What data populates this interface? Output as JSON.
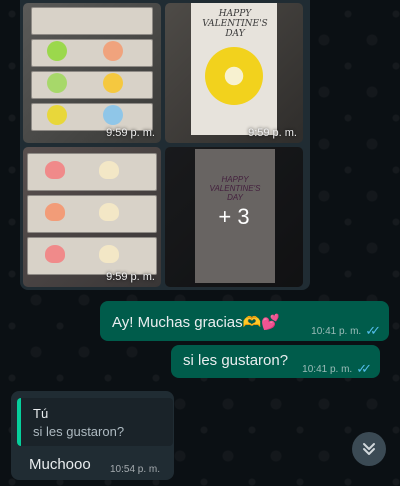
{
  "album": {
    "tiles": [
      {
        "time": "9:59 p. m."
      },
      {
        "time": "9:59 p. m.",
        "card_text": "HAPPY VALENTINE'S DAY"
      },
      {
        "time": "9:59 p. m."
      },
      {
        "overlay": "+ 3",
        "card_text": "HAPPY VALENTINE'S DAY"
      }
    ]
  },
  "messages": [
    {
      "text": "Ay! Muchas gracias🫶💕",
      "time": "10:41 p. m.",
      "ticks": "✓✓",
      "direction": "outgoing"
    },
    {
      "text": "si les gustaron?",
      "time": "10:41 p. m.",
      "ticks": "✓✓",
      "direction": "outgoing"
    }
  ],
  "reply": {
    "quote_author": "Tú",
    "quote_text": "si les gustaron?",
    "text": "Muchooo",
    "time": "10:54 p. m."
  },
  "scroll_button_icon": "double-chevron-down-icon",
  "colors": {
    "background": "#0b1014",
    "outgoing_bubble": "#005c4b",
    "incoming_bubble": "#202c33",
    "read_ticks": "#53bdeb",
    "quote_bar": "#06cf9c"
  }
}
